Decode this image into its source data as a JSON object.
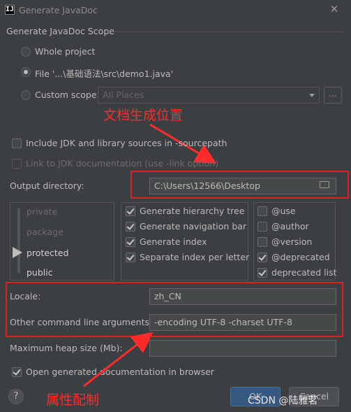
{
  "window": {
    "title": "Generate JavaDoc",
    "icon_text": "IJ"
  },
  "scope": {
    "section_title": "Generate JavaDoc Scope",
    "whole_project": "Whole project",
    "file": "File '...\\基础语法\\src\\demo1.java'",
    "custom_scope": "Custom scope",
    "custom_scope_value": "All Places",
    "selected": "file"
  },
  "options": {
    "include_jdk": "Include JDK and library sources in -sourcepath",
    "link_jdk": "Link to JDK documentation (use -link option)",
    "output_label": "Output directory:",
    "output_value": "C:\\Users\\12566\\Desktop"
  },
  "visibility": {
    "levels": [
      "private",
      "package",
      "protected",
      "public"
    ],
    "selected": "protected"
  },
  "generate": [
    {
      "label": "Generate hierarchy tree",
      "checked": true
    },
    {
      "label": "Generate navigation bar",
      "checked": true
    },
    {
      "label": "Generate index",
      "checked": true
    },
    {
      "label": "Separate index per letter",
      "checked": true
    }
  ],
  "tags": [
    {
      "label": "@use",
      "checked": false
    },
    {
      "label": "@author",
      "checked": false
    },
    {
      "label": "@version",
      "checked": false
    },
    {
      "label": "@deprecated",
      "checked": true
    },
    {
      "label": "deprecated list",
      "checked": true
    }
  ],
  "fields": {
    "locale_label": "Locale:",
    "locale_value": "zh_CN",
    "args_label": "Other command line arguments:",
    "args_value": "-encoding UTF-8 -charset UTF-8",
    "heap_label": "Maximum heap size (Mb):",
    "heap_value": ""
  },
  "open_in_browser": {
    "label": "Open generated documentation in browser",
    "checked": true
  },
  "annotations": {
    "location": "文档生成位置",
    "properties": "属性配制"
  },
  "buttons": {
    "help": "?",
    "ok": "OK",
    "cancel": "Cancel"
  },
  "watermark": "CSDN @陆雅茗",
  "colors": {
    "annotation_red": "#e02020",
    "primary_button": "#365880",
    "background": "#3c3f41"
  }
}
